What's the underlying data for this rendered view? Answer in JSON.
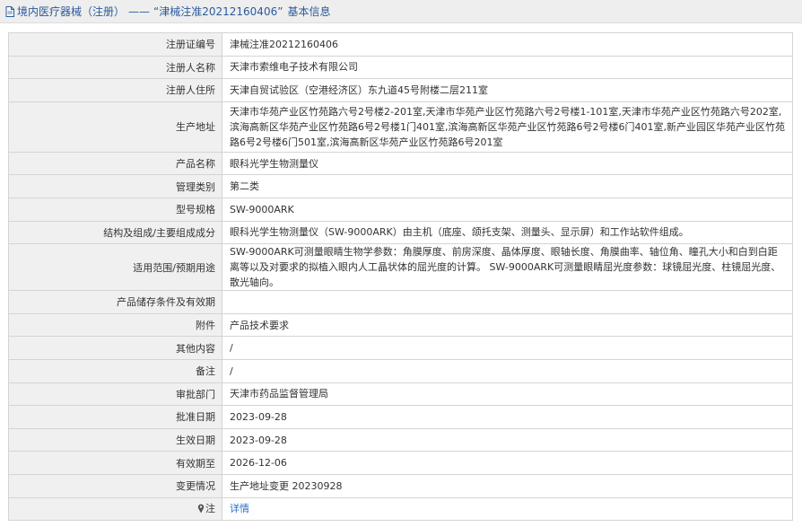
{
  "header": {
    "category": "境内医疗器械（注册）",
    "separator": "——",
    "reg_quote": "“津械注准20212160406”",
    "suffix": "基本信息"
  },
  "rows": [
    {
      "label": "注册证编号",
      "value": "津械注准20212160406"
    },
    {
      "label": "注册人名称",
      "value": "天津市索维电子技术有限公司"
    },
    {
      "label": "注册人住所",
      "value": "天津自贸试验区（空港经济区）东九道45号附楼二层211室"
    },
    {
      "label": "生产地址",
      "value": "天津市华苑产业区竹苑路六号2号楼2-201室,天津市华苑产业区竹苑路六号2号楼1-101室,天津市华苑产业区竹苑路六号202室,滨海高新区华苑产业区竹苑路6号2号楼1门401室,滨海高新区华苑产业区竹苑路6号2号楼6门401室,新产业园区华苑产业区竹苑路6号2号楼6门501室,滨海高新区华苑产业区竹苑路6号201室"
    },
    {
      "label": "产品名称",
      "value": "眼科光学生物测量仪"
    },
    {
      "label": "管理类别",
      "value": "第二类"
    },
    {
      "label": "型号规格",
      "value": "SW-9000ARK"
    },
    {
      "label": "结构及组成/主要组成成分",
      "value": "眼科光学生物测量仪（SW-9000ARK）由主机（底座、颌托支架、测量头、显示屏）和工作站软件组成。"
    },
    {
      "label": "适用范围/预期用途",
      "value": "SW-9000ARK可测量眼睛生物学参数：角膜厚度、前房深度、晶体厚度、眼轴长度、角膜曲率、轴位角、瞳孔大小和白到白距离等以及对要求的拟植入眼内人工晶状体的屈光度的计算。 SW-9000ARK可测量眼睛屈光度参数：球镜屈光度、柱镜屈光度、散光轴向。"
    },
    {
      "label": "产品储存条件及有效期",
      "value": ""
    },
    {
      "label": "附件",
      "value": "产品技术要求"
    },
    {
      "label": "其他内容",
      "value": "/"
    },
    {
      "label": "备注",
      "value": "/"
    },
    {
      "label": "审批部门",
      "value": "天津市药品监督管理局"
    },
    {
      "label": "批准日期",
      "value": "2023-09-28"
    },
    {
      "label": "生效日期",
      "value": "2023-09-28"
    },
    {
      "label": "有效期至",
      "value": "2026-12-06"
    },
    {
      "label": "变更情况",
      "value": "生产地址变更 20230928"
    }
  ],
  "note_row": {
    "label": "注",
    "link": "详情"
  },
  "colors": {
    "link": "#2a6fc9",
    "header_text": "#2a5b9c",
    "label_bg": "#f0f0f0",
    "border": "#d4d4d4"
  },
  "icons": {
    "header": "document-icon",
    "note": "pin-icon"
  }
}
